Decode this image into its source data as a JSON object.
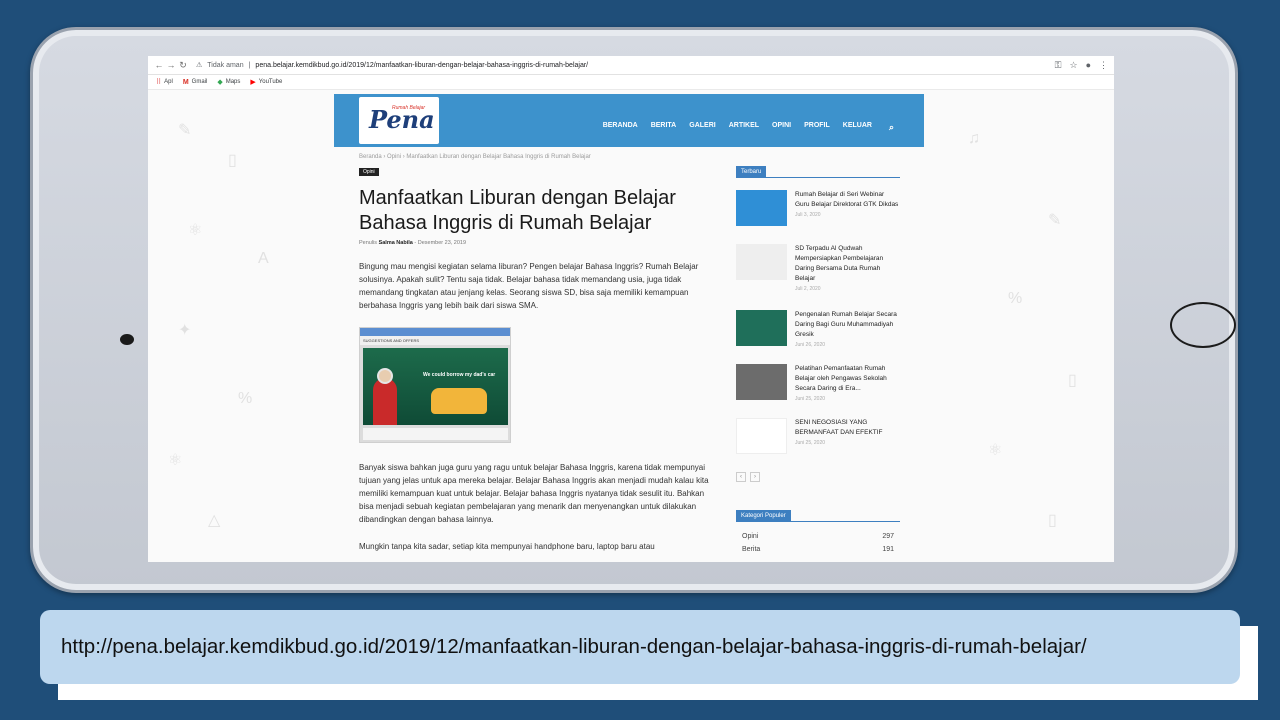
{
  "browser": {
    "not_secure_label": "Tidak aman",
    "url": "pena.belajar.kemdikbud.go.id/2019/12/manfaatkan-liburan-dengan-belajar-bahasa-inggris-di-rumah-belajar/",
    "bookmarks": [
      {
        "label": "Apl",
        "icon": "apps-grid-icon"
      },
      {
        "label": "Gmail",
        "icon": "gmail-icon"
      },
      {
        "label": "Maps",
        "icon": "maps-icon"
      },
      {
        "label": "YouTube",
        "icon": "youtube-icon"
      }
    ]
  },
  "site": {
    "logo_text": "Pena",
    "logo_sub": "Rumah Belajar",
    "nav": [
      "BERANDA",
      "BERITA",
      "GALERI",
      "ARTIKEL",
      "OPINI",
      "PROFIL",
      "KELUAR"
    ]
  },
  "article": {
    "breadcrumb": "Beranda  ›  Opini  ›  Manfaatkan Liburan dengan Belajar Bahasa Inggris di Rumah Belajar",
    "category": "Opini",
    "title": "Manfaatkan Liburan dengan Belajar Bahasa Inggris di Rumah Belajar",
    "author_prefix": "Penulis",
    "author": "Salma Nabila",
    "date": "Desember 23, 2019",
    "paragraphs": [
      "Bingung mau mengisi kegiatan selama liburan? Pengen belajar Bahasa Inggris? Rumah Belajar solusinya. Apakah sulit? Tentu saja tidak. Belajar bahasa tidak memandang usia, juga tidak memandang tingkatan atau jenjang kelas. Seorang siswa SD, bisa saja memiliki kemampuan berbahasa Inggris yang lebih baik dari siswa SMA.",
      "Banyak siswa bahkan juga guru yang ragu untuk belajar Bahasa Inggris, karena tidak mempunyai tujuan yang jelas untuk apa mereka belajar. Belajar Bahasa Inggris akan menjadi mudah kalau kita memiliki kemampuan kuat untuk belajar. Belajar bahasa Inggris nyatanya tidak sesulit itu. Bahkan bisa menjadi sebuah kegiatan pembelajaran yang menarik dan menyenangkan untuk dilakukan dibandingkan dengan bahasa lainnya.",
      "Mungkin tanpa kita sadar, setiap kita mempunyai handphone baru, laptop baru atau"
    ],
    "video_label": "SUGGESTIONS AND OFFERS",
    "video_caption": "We could borrow my dad's car"
  },
  "sidebar": {
    "latest_title": "Terbaru",
    "posts": [
      {
        "title": "Rumah Belajar di Seri Webinar Guru Belajar Direktorat GTK Dikdas",
        "date": "Juli 3, 2020",
        "thumb_color": "#2f8fd6"
      },
      {
        "title": "SD Terpadu Al Qudwah Mempersiapkan Pembelajaran Daring Bersama Duta Rumah Belajar",
        "date": "Juli 2, 2020",
        "thumb_color": "#eeeeee"
      },
      {
        "title": "Pengenalan Rumah Belajar Secara Daring Bagi Guru Muhammadiyah Gresik",
        "date": "Juni 26, 2020",
        "thumb_color": "#1f6f5a"
      },
      {
        "title": "Pelatihan Pemanfaatan Rumah Belajar oleh Pengawas Sekolah Secara Daring di Era...",
        "date": "Juni 25, 2020",
        "thumb_color": "#6c6c6c"
      },
      {
        "title": "SENI NEGOSIASI YANG BERMANFAAT DAN EFEKTIF",
        "date": "Juni 25, 2020",
        "thumb_color": "#ffffff"
      }
    ],
    "popular_title": "Kategori Populer",
    "categories": [
      {
        "name": "Opini",
        "count": "297"
      },
      {
        "name": "Berita",
        "count": "191"
      }
    ]
  },
  "caption": {
    "url": "http://pena.belajar.kemdikbud.go.id/2019/12/manfaatkan-liburan-dengan-belajar-bahasa-inggris-di-rumah-belajar/"
  }
}
